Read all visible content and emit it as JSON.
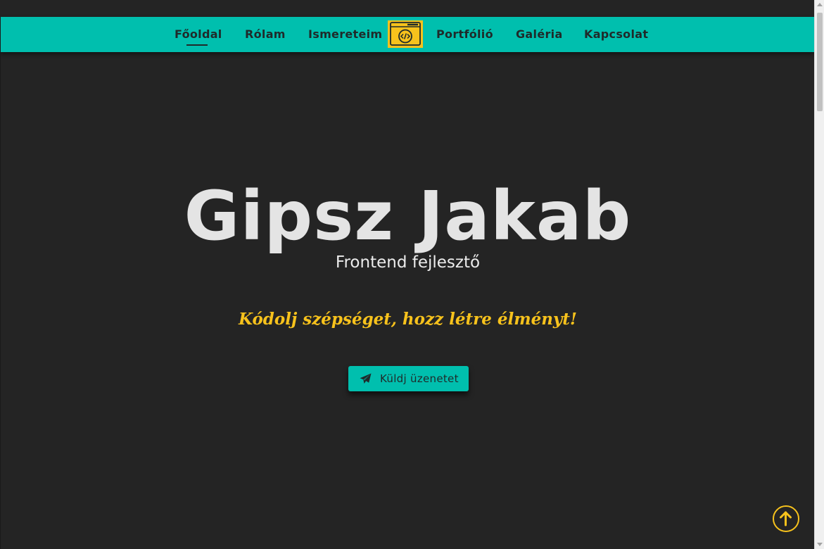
{
  "nav": {
    "items": [
      {
        "label": "Főoldal",
        "active": true
      },
      {
        "label": "Rólam"
      },
      {
        "label": "Ismereteim"
      },
      {
        "label": "Portfólió"
      },
      {
        "label": "Galéria"
      },
      {
        "label": "Kapcsolat"
      }
    ],
    "logo_icon": "code-window-icon"
  },
  "hero": {
    "name": "Gipsz Jakab",
    "role": "Frontend fejlesztő",
    "slogan": "Kódolj szépséget, hozz létre élményt!",
    "cta": {
      "label": "Küldj üzenetet",
      "icon": "paper-plane-icon"
    }
  },
  "back_to_top": {
    "icon": "arrow-up-circle-icon"
  },
  "colors": {
    "accent": "#00bfae",
    "highlight": "#f7c21c",
    "background": "#242424",
    "nav_text": "#1f2a2a",
    "hero_text": "#e4e4e4"
  }
}
